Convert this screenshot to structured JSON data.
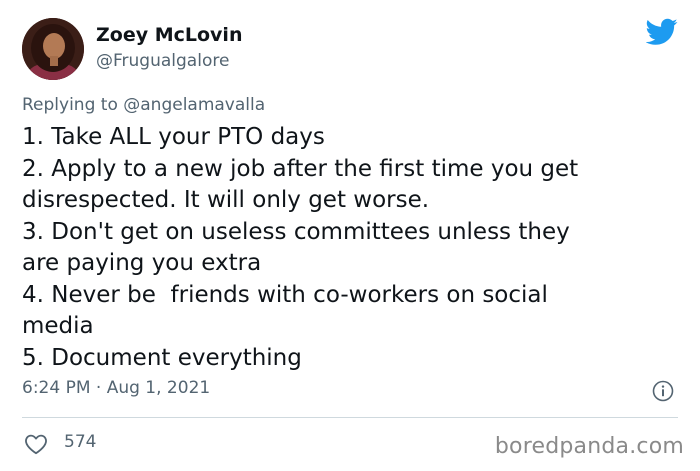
{
  "author": {
    "name": "Zoey McLovin",
    "handle": "@Frugualgalore"
  },
  "reply": {
    "prefix": "Replying to ",
    "mention": "@angelamavalla"
  },
  "tweet": {
    "lines": [
      "1. Take ALL your PTO days",
      "2. Apply to a new job after the first time you get",
      "disrespected. It will only get worse.",
      "3. Don't get on useless committees unless they",
      "are paying you extra",
      "4. Never be  friends with co-workers on social",
      "media",
      "5. Document everything"
    ],
    "timestamp": "6:24 PM · Aug 1, 2021"
  },
  "engagement": {
    "likes": "574"
  },
  "watermark": "boredpanda.com",
  "colors": {
    "twitter_blue": "#1d9bf0",
    "secondary_text": "#536471",
    "divider": "#cfd9de"
  },
  "icons": [
    "twitter-bird-icon",
    "info-icon",
    "heart-icon"
  ]
}
